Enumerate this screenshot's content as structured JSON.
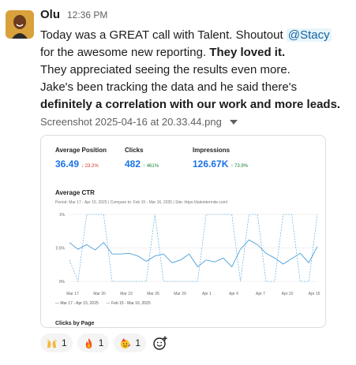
{
  "message": {
    "author": "Olu",
    "time": "12:36 PM",
    "avatar_icon": "user-avatar",
    "p1_a": "Today was a GREAT call with Talent. Shoutout ",
    "mention": "@Stacy",
    "p1_b": " for the awesome new reporting. ",
    "p1_bold": "They loved it.",
    "p2": "They appreciated seeing the results even more.",
    "p3_a": "Jake's been tracking the data and he said there's ",
    "p3_bold": "definitely a correlation with our work and more leads."
  },
  "attachment": {
    "filename": "Screenshot 2025-04-16 at 20.33.44.png"
  },
  "report": {
    "metrics": [
      {
        "label": "Average Position",
        "value": "36.49",
        "delta": "↓ 23.2%",
        "trend": "down"
      },
      {
        "label": "Clicks",
        "value": "482",
        "delta": "↑ 461%",
        "trend": "up"
      },
      {
        "label": "Impressions",
        "value": "126.67K",
        "delta": "↑ 73.9%",
        "trend": "up"
      }
    ],
    "ctr_title": "Average CTR",
    "ctr_subtitle": "Period: Mar 17 - Apr 15, 2025 | Compare to: Feb 15 - Mar 16, 2025 | Site: https://talenttermite.com/",
    "legend_current": "— Mar 17 - Apr 15, 2025",
    "legend_previous": "--- Feb 15 - Mar 16, 2025",
    "next_section": "Clicks by Page"
  },
  "chart_data": {
    "type": "line",
    "title": "Average CTR",
    "y_tick_labels": [
      "1%",
      "0.5%",
      "0%"
    ],
    "ylim": [
      0,
      1
    ],
    "x_tick_labels": [
      "Mar 17",
      "Mar 20",
      "Mar 23",
      "Mar 26",
      "Mar 29",
      "Apr 1",
      "Apr 4",
      "Apr 7",
      "Apr 10",
      "Apr 15"
    ],
    "grid": true,
    "legend_position": "bottom-left",
    "series": [
      {
        "name": "Mar 17 - Apr 15, 2025",
        "style": "solid",
        "color": "#4a9fd8",
        "values": [
          0.58,
          0.48,
          0.55,
          0.47,
          0.58,
          0.41,
          0.41,
          0.42,
          0.38,
          0.3,
          0.38,
          0.41,
          0.28,
          0.32,
          0.41,
          0.22,
          0.32,
          0.29,
          0.35,
          0.22,
          0.48,
          0.62,
          0.55,
          0.42,
          0.35,
          0.26,
          0.34,
          0.42,
          0.28,
          0.52
        ]
      },
      {
        "name": "Feb 15 - Mar 16, 2025",
        "style": "dashed",
        "color": "#4a9fd8",
        "values": [
          0.32,
          0.0,
          1.0,
          1.0,
          1.0,
          0.0,
          0.0,
          0.0,
          0.0,
          0.0,
          1.0,
          0.0,
          0.0,
          0.0,
          0.0,
          0.0,
          1.0,
          1.0,
          1.0,
          1.0,
          0.0,
          1.0,
          1.0,
          0.0,
          0.0,
          1.0,
          1.0,
          0.0,
          0.0,
          1.0
        ]
      }
    ]
  },
  "reactions": [
    {
      "icon": "raised-hands-emoji",
      "count": "1"
    },
    {
      "icon": "fire-emoji",
      "count": "1"
    },
    {
      "icon": "party-face-emoji",
      "count": "1"
    }
  ],
  "add_reaction_icon": "add-reaction-icon",
  "colors": {
    "mention_text": "#1264a3",
    "mention_bg": "#e8f5fa",
    "metric_blue": "#1a73e8"
  }
}
